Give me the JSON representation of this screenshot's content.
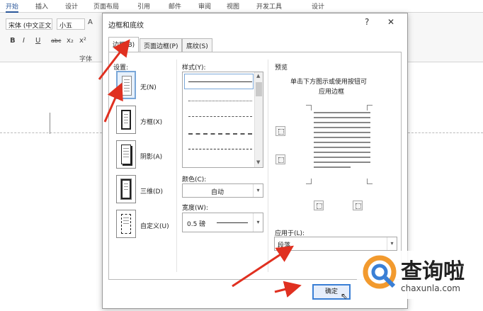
{
  "ribbon": {
    "tabs": [
      "开始",
      "插入",
      "设计",
      "页面布局",
      "引用",
      "邮件",
      "审阅",
      "视图",
      "开发工具",
      "设计"
    ],
    "font_name": "宋体 (中文正文",
    "font_size": "小五",
    "font_group_label": "字体",
    "format_buttons": [
      "B",
      "I",
      "U",
      "abc",
      "x₂",
      "x²",
      "A"
    ]
  },
  "dialog": {
    "title": "边框和底纹",
    "help": "?",
    "close": "✕",
    "tabs": [
      "边框(B)",
      "页面边框(P)",
      "底纹(S)"
    ],
    "setting_label": "设置:",
    "settings": [
      "无(N)",
      "方框(X)",
      "阴影(A)",
      "三维(D)",
      "自定义(U)"
    ],
    "style_label": "样式(Y):",
    "color_label": "颜色(C):",
    "color_value": "自动",
    "width_label": "宽度(W):",
    "width_value": "0.5 磅",
    "preview_label": "预览",
    "preview_hint_1": "单击下方图示或使用按钮可",
    "preview_hint_2": "应用边框",
    "apply_label": "应用于(L):",
    "apply_value": "段落",
    "ok": "确定"
  },
  "watermark": {
    "name": "查询啦",
    "url": "chaxunla.com"
  },
  "colors": {
    "accent": "#2b579a",
    "arrow": "#e03020",
    "selection": "#7aa7d8"
  }
}
